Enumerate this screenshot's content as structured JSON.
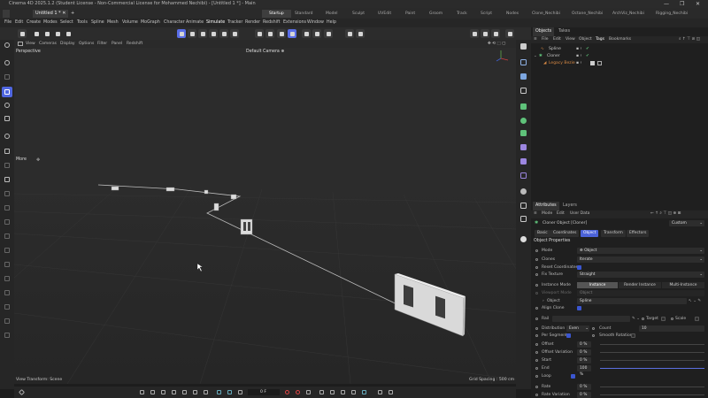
{
  "window": {
    "title": "Cinema 4D 2025.1.2 (Student License - Non-Commercial License for Mohammed Nechibi) - [Untitled 1 *] - Main",
    "minimize": "—",
    "maximize": "❐",
    "close": "✕"
  },
  "tabs": {
    "document_tab": "Untitled 1 *",
    "add_tab": "+",
    "layouts": [
      "Startup",
      "Standard",
      "Model",
      "Sculpt",
      "UVEdit",
      "Paint",
      "Groom",
      "Track",
      "Script",
      "Nodes",
      "Clone_Nechibi",
      "Octane_Nechibi",
      "ArchViz_Nechibi",
      "Rigging_Nechibi"
    ],
    "active_layout": "Startup"
  },
  "menubar": [
    "File",
    "Edit",
    "Create",
    "Modes",
    "Select",
    "Tools",
    "Spline",
    "Mesh",
    "Volume",
    "MoGraph",
    "Character",
    "Animate",
    "Simulate",
    "Tracker",
    "Render",
    "Redshift",
    "Extensions",
    "Window",
    "Help"
  ],
  "viewport": {
    "menu": [
      "View",
      "Cameras",
      "Display",
      "Options",
      "Filter",
      "Panel",
      "Redshift"
    ],
    "label": "Perspective",
    "camera": "Default Camera",
    "more_label": "More",
    "status_left": "View Transform: Scene",
    "grid_spacing": "Grid Spacing : 500 cm"
  },
  "timeline": {
    "frame": "0 F"
  },
  "objects_panel": {
    "tabs": [
      "Objects",
      "Takes"
    ],
    "menu": [
      "File",
      "Edit",
      "View",
      "Object",
      "Tags",
      "Bookmarks"
    ],
    "rows": [
      {
        "name": "Spline",
        "color": "#c8c8c8"
      },
      {
        "name": "Cloner",
        "color": "#c8c8c8"
      },
      {
        "name": "Legacy Bezie",
        "color": "#d98a44"
      }
    ]
  },
  "attributes_panel": {
    "tabs": [
      "Attributes",
      "Layers"
    ],
    "menu": [
      "Mode",
      "Edit",
      "User Data"
    ],
    "mode_select": "Custom",
    "object_title": "Cloner Object [Cloner]",
    "subtabs": [
      "Basic",
      "Coordinates",
      "Object",
      "Transform",
      "Effectors"
    ],
    "active_subtab": "Object",
    "section": "Object Properties",
    "mode": "Object",
    "clones": "Iterate",
    "fix_texture": "Straight",
    "instance_modes": [
      "Instance",
      "Render Instance",
      "Multi-Instance"
    ],
    "labels": {
      "mode": "Mode",
      "clones": "Clones",
      "reset_coordinates": "Reset Coordinates",
      "fix_texture": "Fix Texture",
      "instance_mode": "Instance Mode",
      "viewport_mode": "Viewport Mode",
      "object": "Object",
      "align_clone": "Align Clone",
      "rail": "Rail",
      "target": "Target",
      "scale": "Scale",
      "distribution": "Distribution",
      "count": "Count",
      "per_segment": "Per Segment",
      "smooth_rotation": "Smooth Rotation",
      "offset": "Offset",
      "offset_variation": "Offset Variation",
      "start": "Start",
      "end": "End",
      "loop": "Loop",
      "rate": "Rate",
      "rate_variation": "Rate Variation"
    },
    "object_field": "Spline",
    "distribution": "Even",
    "count": "10",
    "offset": "0 %",
    "offset_variation": "0 %",
    "start": "0 %",
    "end": "100 %",
    "rate": "0 %",
    "rate_variation": "0 %"
  }
}
